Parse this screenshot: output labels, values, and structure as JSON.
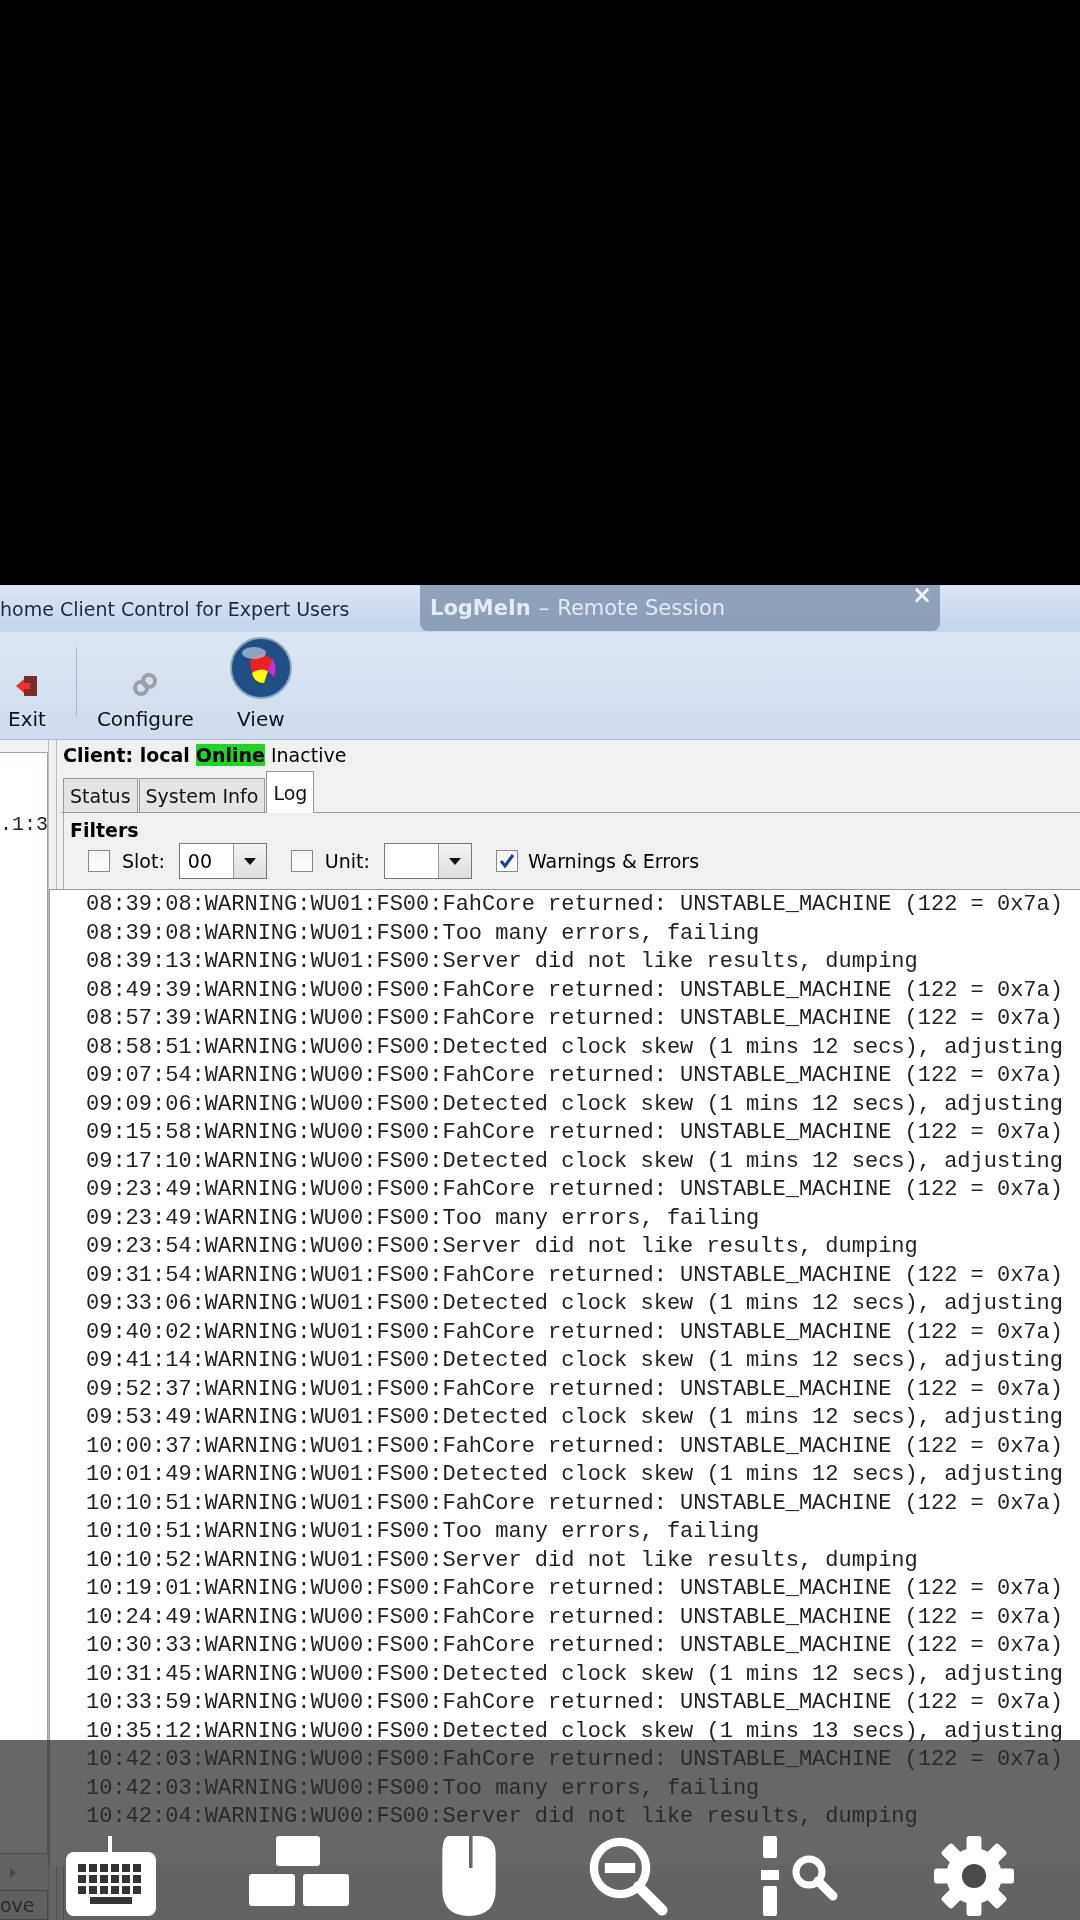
{
  "window": {
    "title": "home Client Control for Expert Users"
  },
  "remote_banner": {
    "brand": "LogMeIn",
    "separator": "–",
    "label": "Remote Session",
    "close": "×"
  },
  "toolbar": [
    {
      "kind": "exit",
      "label": "Exit"
    },
    {
      "kind": "configure",
      "label": "Configure"
    },
    {
      "kind": "view",
      "label": "View"
    }
  ],
  "left_panel": {
    "list_text": ".1:3",
    "button": "ove"
  },
  "client": {
    "label": "Client: local",
    "status": "Online",
    "state": "Inactive"
  },
  "tabs": [
    {
      "label": "Status",
      "selected": false
    },
    {
      "label": "System Info",
      "selected": false
    },
    {
      "label": "Log",
      "selected": true
    }
  ],
  "filters": {
    "title": "Filters",
    "slot": {
      "label": "Slot:",
      "checked": false,
      "value": "00"
    },
    "unit": {
      "label": "Unit:",
      "checked": false
    },
    "warnings": {
      "label": "Warnings & Errors",
      "checked": true
    }
  },
  "log_lines": [
    "08:39:08:WARNING:WU01:FS00:FahCore returned: UNSTABLE_MACHINE (122 = 0x7a)",
    "08:39:08:WARNING:WU01:FS00:Too many errors, failing",
    "08:39:13:WARNING:WU01:FS00:Server did not like results, dumping",
    "08:49:39:WARNING:WU00:FS00:FahCore returned: UNSTABLE_MACHINE (122 = 0x7a)",
    "08:57:39:WARNING:WU00:FS00:FahCore returned: UNSTABLE_MACHINE (122 = 0x7a)",
    "08:58:51:WARNING:WU00:FS00:Detected clock skew (1 mins 12 secs), adjusting",
    "09:07:54:WARNING:WU00:FS00:FahCore returned: UNSTABLE_MACHINE (122 = 0x7a)",
    "09:09:06:WARNING:WU00:FS00:Detected clock skew (1 mins 12 secs), adjusting",
    "09:15:58:WARNING:WU00:FS00:FahCore returned: UNSTABLE_MACHINE (122 = 0x7a)",
    "09:17:10:WARNING:WU00:FS00:Detected clock skew (1 mins 12 secs), adjusting",
    "09:23:49:WARNING:WU00:FS00:FahCore returned: UNSTABLE_MACHINE (122 = 0x7a)",
    "09:23:49:WARNING:WU00:FS00:Too many errors, failing",
    "09:23:54:WARNING:WU00:FS00:Server did not like results, dumping",
    "09:31:54:WARNING:WU01:FS00:FahCore returned: UNSTABLE_MACHINE (122 = 0x7a)",
    "09:33:06:WARNING:WU01:FS00:Detected clock skew (1 mins 12 secs), adjusting",
    "09:40:02:WARNING:WU01:FS00:FahCore returned: UNSTABLE_MACHINE (122 = 0x7a)",
    "09:41:14:WARNING:WU01:FS00:Detected clock skew (1 mins 12 secs), adjusting",
    "09:52:37:WARNING:WU01:FS00:FahCore returned: UNSTABLE_MACHINE (122 = 0x7a)",
    "09:53:49:WARNING:WU01:FS00:Detected clock skew (1 mins 12 secs), adjusting",
    "10:00:37:WARNING:WU01:FS00:FahCore returned: UNSTABLE_MACHINE (122 = 0x7a)",
    "10:01:49:WARNING:WU01:FS00:Detected clock skew (1 mins 12 secs), adjusting",
    "10:10:51:WARNING:WU01:FS00:FahCore returned: UNSTABLE_MACHINE (122 = 0x7a)",
    "10:10:51:WARNING:WU01:FS00:Too many errors, failing",
    "10:10:52:WARNING:WU01:FS00:Server did not like results, dumping",
    "10:19:01:WARNING:WU00:FS00:FahCore returned: UNSTABLE_MACHINE (122 = 0x7a)",
    "10:24:49:WARNING:WU00:FS00:FahCore returned: UNSTABLE_MACHINE (122 = 0x7a)",
    "10:30:33:WARNING:WU00:FS00:FahCore returned: UNSTABLE_MACHINE (122 = 0x7a)",
    "10:31:45:WARNING:WU00:FS00:Detected clock skew (1 mins 12 secs), adjusting",
    "10:33:59:WARNING:WU00:FS00:FahCore returned: UNSTABLE_MACHINE (122 = 0x7a)",
    "10:35:12:WARNING:WU00:FS00:Detected clock skew (1 mins 13 secs), adjusting",
    "10:42:03:WARNING:WU00:FS00:FahCore returned: UNSTABLE_MACHINE (122 = 0x7a)",
    "10:42:03:WARNING:WU00:FS00:Too many errors, failing",
    "10:42:04:WARNING:WU00:FS00:Server did not like results, dumping"
  ],
  "overlay_toolbar": [
    {
      "kind": "keyboard"
    },
    {
      "kind": "windows"
    },
    {
      "kind": "mouse"
    },
    {
      "kind": "zoom-out"
    },
    {
      "kind": "text-zoom"
    },
    {
      "kind": "settings"
    }
  ]
}
